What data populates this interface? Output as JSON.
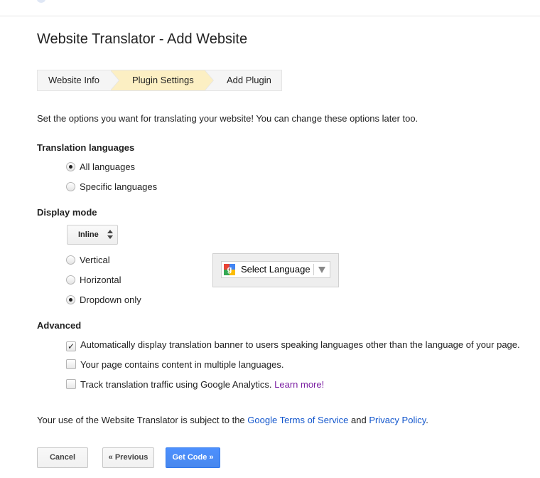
{
  "page": {
    "title": "Website Translator - Add Website"
  },
  "steps": [
    {
      "label": "Website Info"
    },
    {
      "label": "Plugin Settings",
      "active": true
    },
    {
      "label": "Add Plugin"
    }
  ],
  "intro": "Set the options you want for translating your website! You can change these options later too.",
  "translation_languages": {
    "heading": "Translation languages",
    "options": [
      {
        "label": "All languages",
        "selected": true
      },
      {
        "label": "Specific languages",
        "selected": false
      }
    ]
  },
  "display_mode": {
    "heading": "Display mode",
    "select_value": "Inline",
    "options": [
      {
        "label": "Vertical",
        "selected": false
      },
      {
        "label": "Horizontal",
        "selected": false
      },
      {
        "label": "Dropdown only",
        "selected": true
      }
    ],
    "preview": {
      "label": "Select Language",
      "icon": "google-translate-icon"
    }
  },
  "advanced": {
    "heading": "Advanced",
    "options": [
      {
        "label": "Automatically display translation banner to users speaking languages other than the language of your page.",
        "checked": true
      },
      {
        "label": "Your page contains content in multiple languages.",
        "checked": false
      },
      {
        "label": "Track translation traffic using Google Analytics.",
        "checked": false,
        "link": "Learn more!"
      }
    ]
  },
  "footer": {
    "prefix": "Your use of the Website Translator is subject to the ",
    "tos_link": "Google Terms of Service",
    "middle": " and ",
    "privacy_link": "Privacy Policy",
    "suffix": "."
  },
  "buttons": {
    "cancel": "Cancel",
    "previous": "« Previous",
    "get_code": "Get Code »"
  },
  "colors": {
    "accent": "#4d90fe",
    "active_step": "#fcefc3",
    "link": "#1a0dab"
  }
}
